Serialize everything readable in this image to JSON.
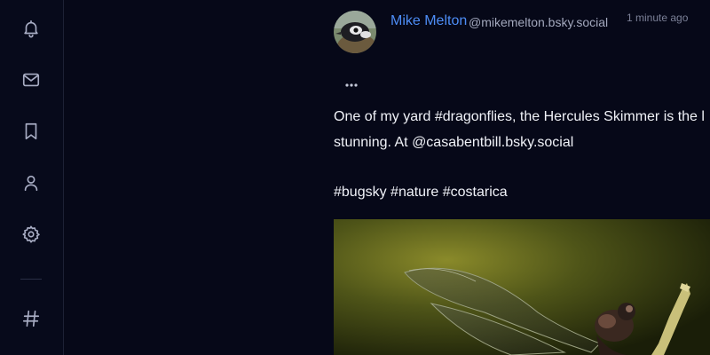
{
  "sidebar": {
    "items": [
      {
        "name": "notifications",
        "icon": "bell-icon"
      },
      {
        "name": "messages",
        "icon": "envelope-icon"
      },
      {
        "name": "bookmarks",
        "icon": "bookmark-icon"
      },
      {
        "name": "profile",
        "icon": "user-icon"
      },
      {
        "name": "settings",
        "icon": "gear-icon"
      },
      {
        "name": "hashtags",
        "icon": "hashtag-icon"
      }
    ]
  },
  "post": {
    "author_name": "Mike Melton",
    "author_handle": "@mikemelton.bsky.social",
    "timestamp": "1 minute ago",
    "more_icon": "ellipsis-icon",
    "text_line1": "One of my yard #dragonflies, the Hercules Skimmer is the l",
    "text_line2": "stunning. At @casabentbill.bsky.social",
    "tags": "#bugsky #nature #costarica",
    "image": "dragonfly-photo"
  },
  "colors": {
    "background": "#060818",
    "accent": "#4d8df6",
    "icon": "#a8adc4"
  }
}
